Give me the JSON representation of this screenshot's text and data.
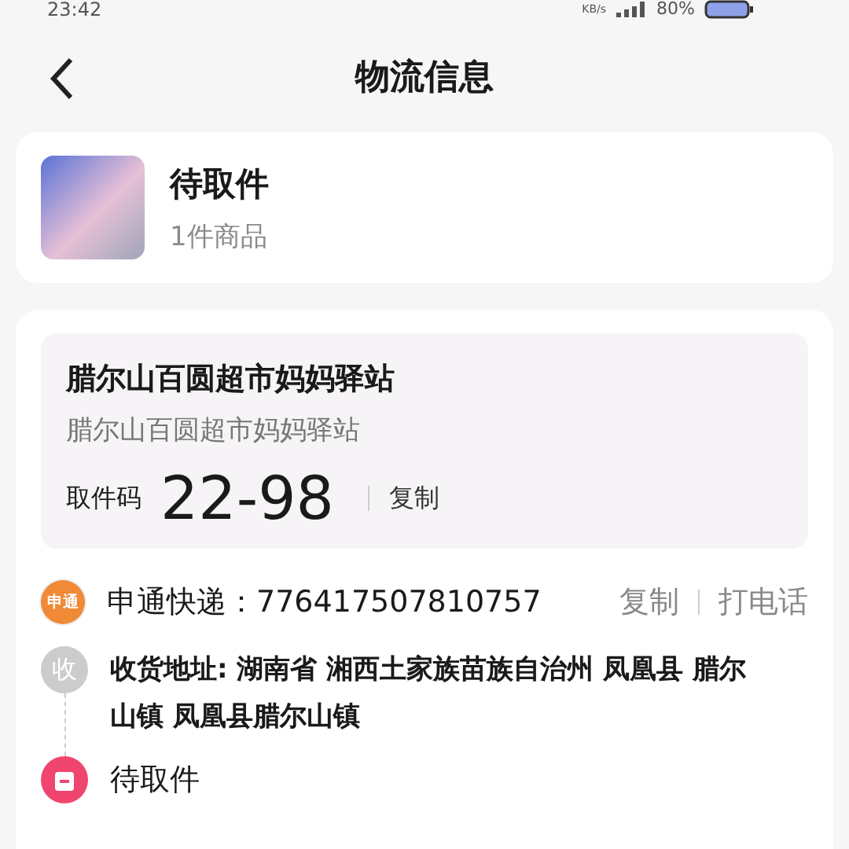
{
  "status_bar": {
    "time": "23:42",
    "speed": "KB/s",
    "battery": "80%"
  },
  "header": {
    "title": "物流信息"
  },
  "package": {
    "status": "待取件",
    "count": "1件商品"
  },
  "pickup": {
    "station": "腊尔山百圆超市妈妈驿站",
    "address": "腊尔山百圆超市妈妈驿站",
    "code_label": "取件码",
    "code": "22-98",
    "copy": "复制"
  },
  "courier": {
    "logo": "申通",
    "label": "申通快递：776417507810757",
    "copy": "复制",
    "call": "打电话"
  },
  "timeline": [
    {
      "kind": "address",
      "marker": "收",
      "text": "收货地址: 湖南省 湘西土家族苗族自治州 凤凰县 腊尔山镇 凤凰县腊尔山镇"
    },
    {
      "kind": "status",
      "text": "待取件"
    }
  ]
}
